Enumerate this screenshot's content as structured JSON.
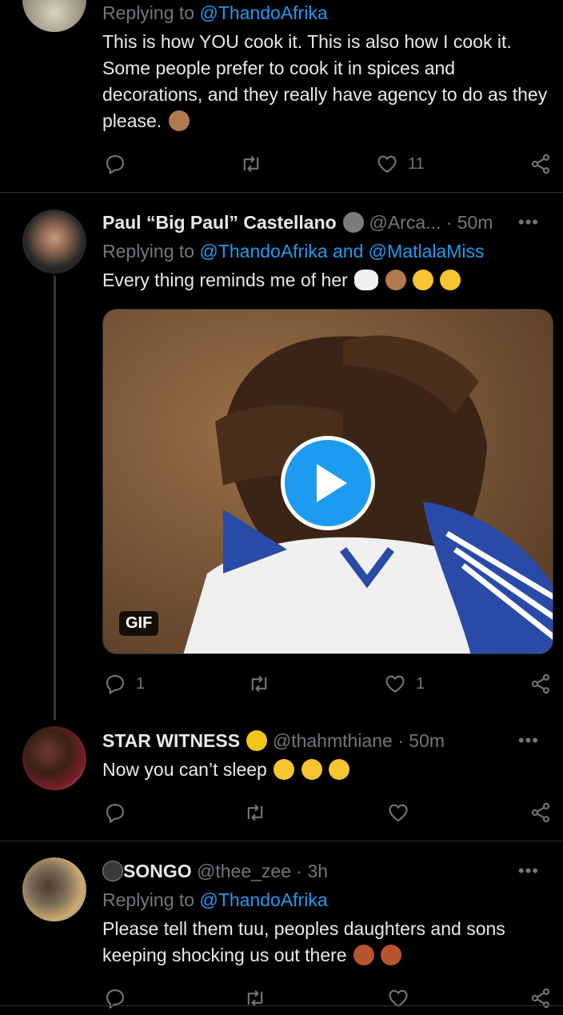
{
  "tweets": [
    {
      "reply_prefix": "Replying to",
      "mentions": [
        "@ThandoAfrika"
      ],
      "text": "This is how YOU cook it. This is also how I cook it. Some people prefer to cook it in spices and decorations, and they really have agency to do as they please.",
      "counts": {
        "reply": "",
        "retweet": "",
        "like": "11"
      }
    },
    {
      "name": "Paul “Big Paul” Castellano",
      "handle": "@Arca...",
      "time": "· 50m",
      "reply_prefix": "Replying to",
      "mentions": [
        "@ThandoAfrika",
        "and",
        "@MatlalaMiss"
      ],
      "text": "Every thing reminds me of her",
      "media_badge": "GIF",
      "counts": {
        "reply": "1",
        "retweet": "",
        "like": "1"
      }
    },
    {
      "name": "STAR WITNESS",
      "handle": "@thahmthiane",
      "time": "· 50m",
      "text": "Now you can’t sleep",
      "counts": {
        "reply": "",
        "retweet": "",
        "like": ""
      }
    },
    {
      "name": "SONGO",
      "handle": "@thee_zee",
      "time": "· 3h",
      "reply_prefix": "Replying to",
      "mentions": [
        "@ThandoAfrika"
      ],
      "text": "Please tell them tuu, peoples daughters and sons keeping shocking us out there",
      "counts": {
        "reply": "",
        "retweet": "",
        "like": ""
      }
    }
  ],
  "icons": {
    "reply": "reply-icon",
    "retweet": "retweet-icon",
    "like": "heart-icon",
    "share": "share-icon",
    "more": "more-icon"
  },
  "colors": {
    "background": "#000000",
    "accent": "#1d9bf0",
    "muted": "#71767b",
    "separator": "#2f3336"
  }
}
